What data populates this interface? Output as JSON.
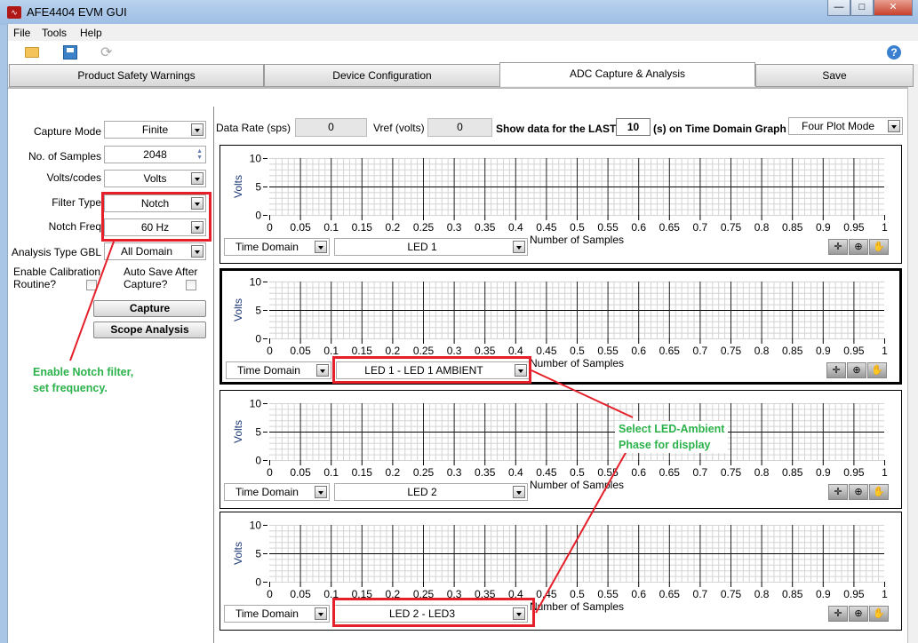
{
  "window": {
    "title": "AFE4404 EVM GUI",
    "controls": [
      "—",
      "□",
      "✕"
    ]
  },
  "menu": [
    "File",
    "Tools",
    "Help"
  ],
  "toolbar": {
    "icons": [
      "folder-open-icon",
      "save-icon",
      "refresh-icon"
    ],
    "help": "?"
  },
  "tabs": [
    "Product Safety Warnings",
    "Device Configuration",
    "ADC Capture & Analysis",
    "Save"
  ],
  "active_tab": "ADC Capture & Analysis",
  "left": {
    "capture_mode": {
      "label": "Capture Mode",
      "value": "Finite"
    },
    "samples": {
      "label": "No. of Samples",
      "value": "2048"
    },
    "units": {
      "label": "Volts/codes",
      "value": "Volts"
    },
    "filter_type": {
      "label": "Filter Type",
      "value": "Notch"
    },
    "notch_freq": {
      "label": "Notch Freq",
      "value": "60 Hz"
    },
    "analysis": {
      "label": "Analysis Type GBL",
      "value": "All Domain"
    },
    "calib": {
      "label1": "Enable Calibration",
      "label2": "Routine?"
    },
    "autosave": {
      "label1": "Auto Save After",
      "label2": "Capture?"
    },
    "capture_btn": "Capture",
    "scope_btn": "Scope Analysis"
  },
  "top": {
    "rate_label": "Data Rate (sps)",
    "rate": "0",
    "vref_label": "Vref (volts)",
    "vref": "0",
    "show_label": "Show data for the LAST",
    "show": "10",
    "show_suffix": "(s) on Time Domain Graph",
    "mode": "Four Plot Mode"
  },
  "plots": [
    {
      "domain": "Time Domain",
      "signal": "LED 1"
    },
    {
      "domain": "Time Domain",
      "signal": "LED 1 - LED 1 AMBIENT"
    },
    {
      "domain": "Time Domain",
      "signal": "LED 2"
    },
    {
      "domain": "Time Domain",
      "signal": "LED 2 - LED3"
    }
  ],
  "axes": {
    "ylabel": "Volts",
    "xlabel": "Number of Samples",
    "yticks": [
      "10",
      "5",
      "0"
    ],
    "xticks": [
      "0",
      "0.05",
      "0.1",
      "0.15",
      "0.2",
      "0.25",
      "0.3",
      "0.35",
      "0.4",
      "0.45",
      "0.5",
      "0.55",
      "0.6",
      "0.65",
      "0.7",
      "0.75",
      "0.8",
      "0.85",
      "0.9",
      "0.95",
      "1"
    ]
  },
  "annotations": {
    "notch": [
      "Enable Notch filter,",
      "set  frequency."
    ],
    "led": [
      "Select LED-Ambient",
      "Phase for display"
    ],
    "color_box": "#e5202a",
    "color_text": "#2bb24a"
  }
}
